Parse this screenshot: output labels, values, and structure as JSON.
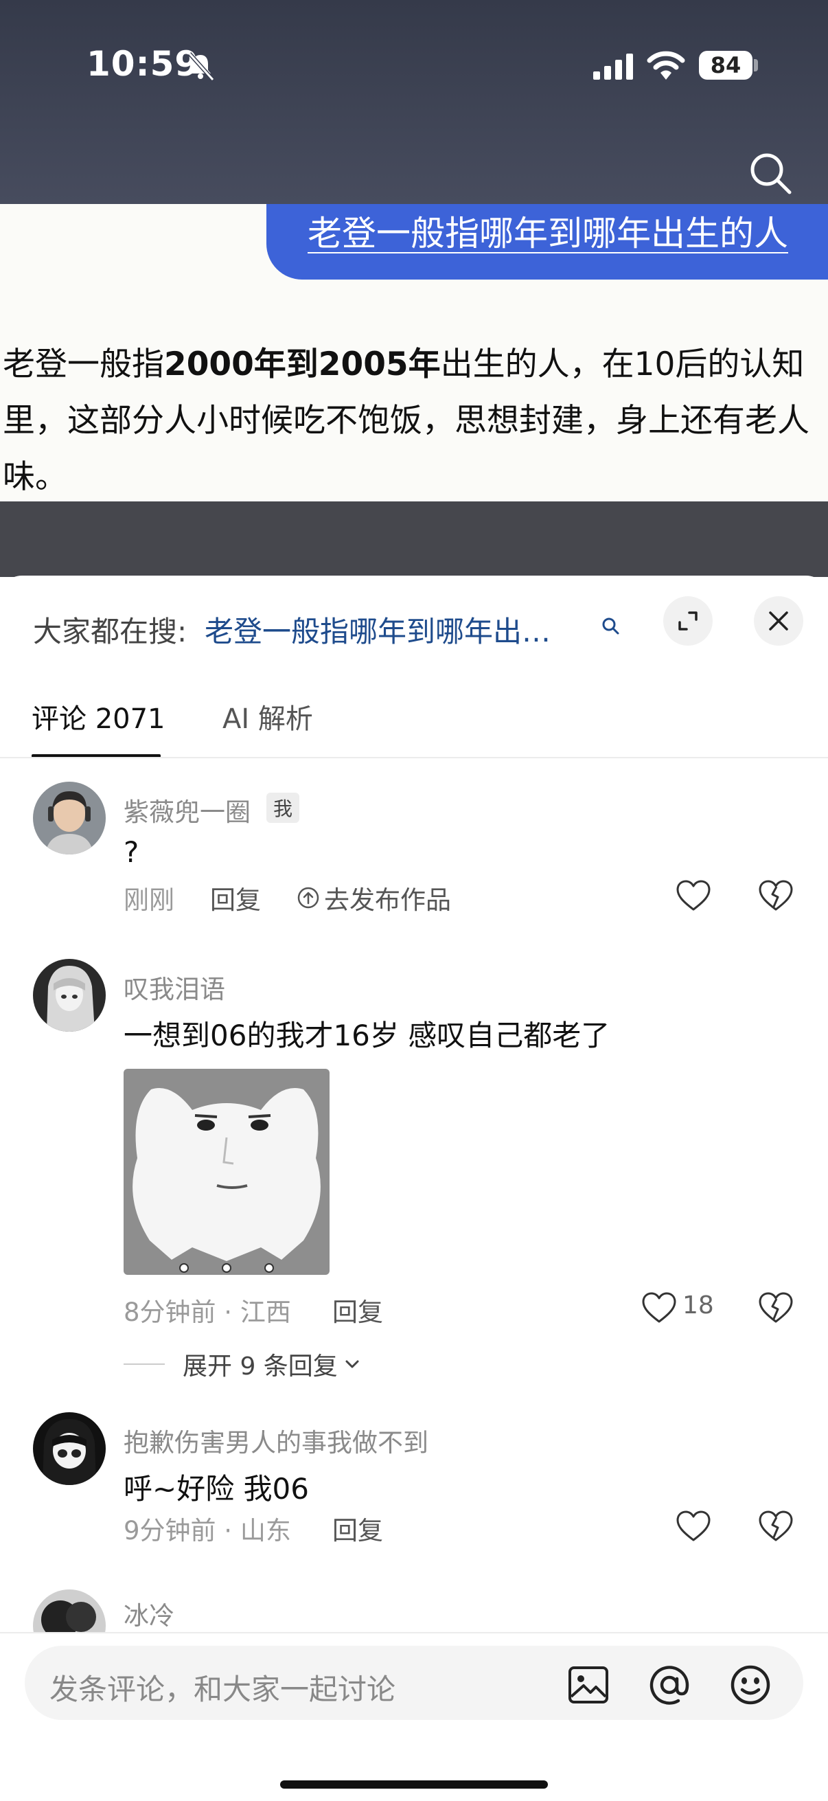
{
  "status_bar": {
    "time": "10:59",
    "battery": "84"
  },
  "chat": {
    "user_question": "老登一般指哪年到哪年出生的人",
    "answer_part1": "老登一般指",
    "answer_bold": "2000年到2005年",
    "answer_part2": "出生的人，在10后的认知里，这部分人小时候吃不饱饭，思想封建，身上还有老人味。"
  },
  "sheet": {
    "search_label": "大家都在搜:",
    "search_query": "老登一般指哪年到哪年出…",
    "tabs": [
      {
        "label": "评论 2071",
        "active": true
      },
      {
        "label": "AI 解析",
        "active": false
      }
    ]
  },
  "comments": [
    {
      "name": "紫薇兜一圈",
      "badge": "我",
      "text": "?",
      "time": "刚刚",
      "reply": "回复",
      "publish": "去发布作品"
    },
    {
      "name": "叹我泪语",
      "text": "一想到06的我才16岁  感叹自己都老了",
      "time": "8分钟前 · 江西",
      "reply": "回复",
      "likes": "18",
      "expand": "展开 9 条回复"
    },
    {
      "name": "抱歉伤害男人的事我做不到",
      "text": "呼~好险 我06",
      "time": "9分钟前 · 山东",
      "reply": "回复"
    },
    {
      "name": "冰冷"
    }
  ],
  "input": {
    "placeholder": "发条评论，和大家一起讨论"
  },
  "colors": {
    "accent_blue": "#3d63d8",
    "link_blue": "#1e4b8c",
    "top_bar": "#3d4253"
  }
}
